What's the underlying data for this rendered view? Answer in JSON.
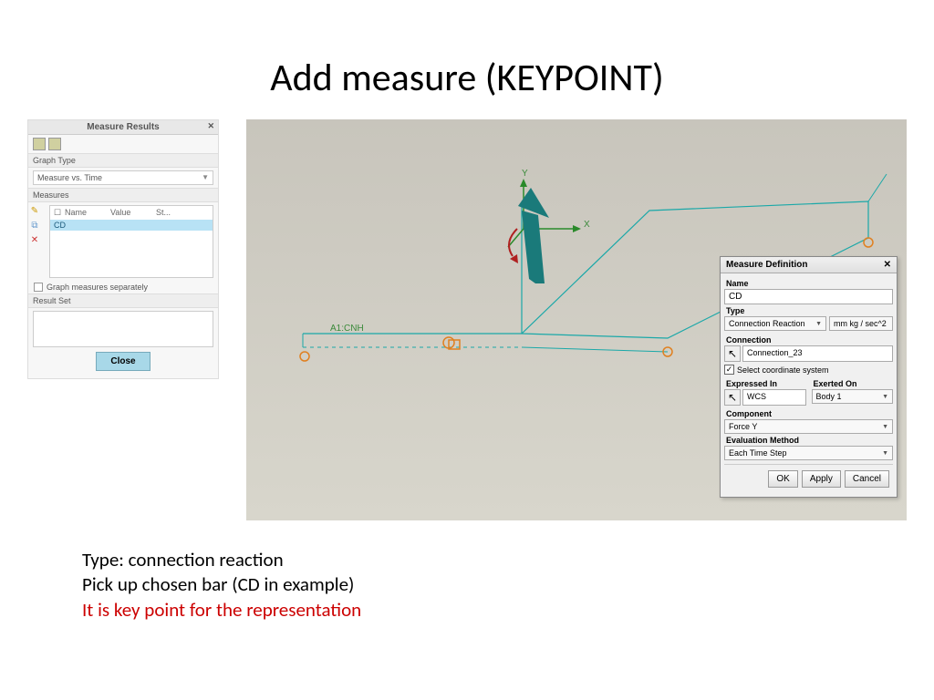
{
  "title": "Add measure (KEYPOINT)",
  "measure_results": {
    "panel_title": "Measure Results",
    "graph_type_label": "Graph Type",
    "graph_type_value": "Measure vs. Time",
    "measures_label": "Measures",
    "col_name": "Name",
    "col_value": "Value",
    "col_st": "St...",
    "selected_row": "CD",
    "graph_checkbox": "Graph measures separately",
    "result_set_label": "Result Set",
    "close_btn": "Close"
  },
  "viewport": {
    "axis_x": "X",
    "axis_y": "Y",
    "annotation": "A1:CNH"
  },
  "measure_definition": {
    "dialog_title": "Measure Definition",
    "name_label": "Name",
    "name_value": "CD",
    "type_label": "Type",
    "type_value": "Connection Reaction",
    "unit_value": "mm kg / sec^2",
    "connection_label": "Connection",
    "connection_value": "Connection_23",
    "select_cs": "Select coordinate system",
    "expressed_in_label": "Expressed In",
    "expressed_in_value": "WCS",
    "exerted_on_label": "Exerted On",
    "exerted_on_value": "Body 1",
    "component_label": "Component",
    "component_value": "Force Y",
    "eval_method_label": "Evaluation Method",
    "eval_method_value": "Each Time Step",
    "ok": "OK",
    "apply": "Apply",
    "cancel": "Cancel"
  },
  "notes": {
    "line1": "Type: connection reaction",
    "line2": "Pick up chosen bar (CD in example)",
    "line3": "It is key point for the representation"
  }
}
